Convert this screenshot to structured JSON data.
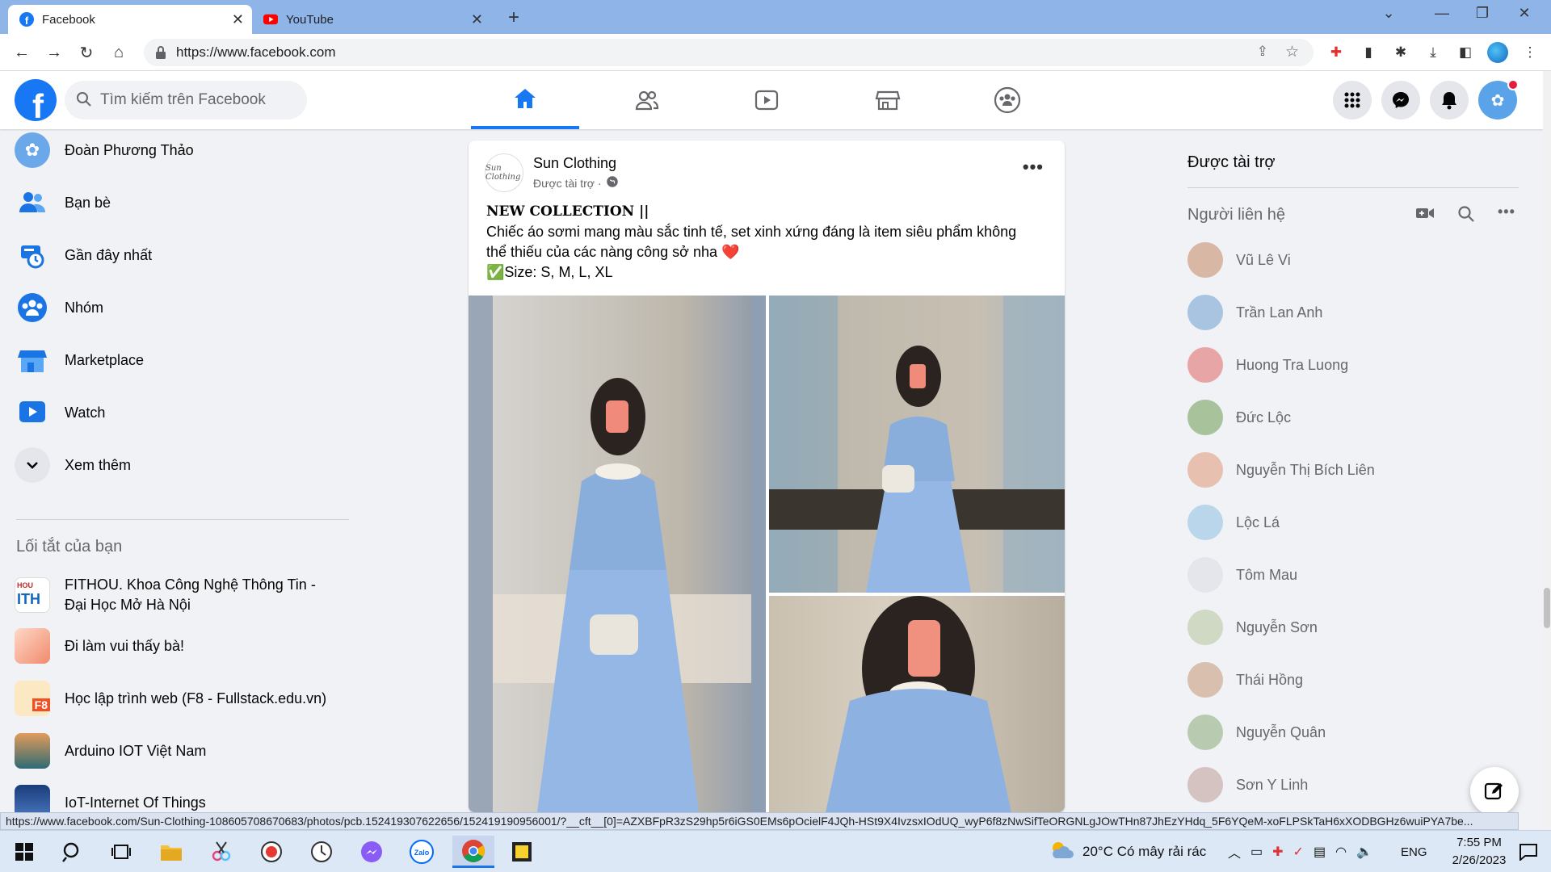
{
  "browser": {
    "tabs": [
      {
        "title": "Facebook",
        "active": true
      },
      {
        "title": "YouTube",
        "active": false
      }
    ],
    "url": "https://www.facebook.com",
    "status_url": "https://www.facebook.com/Sun-Clothing-108605708670683/photos/pcb.152419307622656/152419190956001/?__cft__[0]=AZXBFpR3zS29hp5r6iGS0EMs6pOcielF4JQh-HSt9X4IvzsxIOdUQ_wyP6f8zNwSifTeORGNLgJOwTHn87JhEzYHdq_5F6YQeM-xoFLPSkTaH6xXODBGHz6wuiPYA7be..."
  },
  "facebook": {
    "search_placeholder": "Tìm kiếm trên Facebook",
    "nav_tabs": [
      "home",
      "friends",
      "watch",
      "marketplace",
      "groups"
    ]
  },
  "left_nav": {
    "profile": "Đoàn Phương Thảo",
    "items": [
      "Bạn bè",
      "Gần đây nhất",
      "Nhóm",
      "Marketplace",
      "Watch",
      "Xem thêm"
    ],
    "shortcuts_title": "Lối tắt của bạn",
    "shortcuts": [
      {
        "line1": "FITHOU. Khoa Công Nghệ Thông Tin -",
        "line2": "Đại Học Mở Hà Nội"
      },
      {
        "line1": "Đi làm vui thấy bà!",
        "line2": ""
      },
      {
        "line1": "Học lập trình web (F8 - Fullstack.edu.vn)",
        "line2": ""
      },
      {
        "line1": "Arduino IOT Việt Nam",
        "line2": ""
      },
      {
        "line1": "IoT-Internet Of Things",
        "line2": ""
      }
    ]
  },
  "post": {
    "author": "Sun Clothing",
    "sponsored": "Được tài trợ ·",
    "avatar_text": "Sun Clothing",
    "line1": "NEW COLLECTION ||",
    "line2": "Chiếc áo sơmi mang màu sắc tinh tế, set xinh xứng đáng là item siêu phẩm không",
    "line3": "thể thiếu của các nàng công sở nha ❤️",
    "line4": "✅Size: S, M, L, XL"
  },
  "right_col": {
    "sponsored_title": "Được tài trợ",
    "contacts_title": "Người liên hệ",
    "contacts": [
      "Vũ Lê Vi",
      "Trần Lan Anh",
      "Huong Tra Luong",
      "Đức Lộc",
      "Nguyễn Thị Bích Liên",
      "Lộc Lá",
      "Tôm Mau",
      "Nguyễn Sơn",
      "Thái Hồng",
      "Nguyễn Quân",
      "Sơn Y Linh"
    ]
  },
  "taskbar": {
    "weather": "20°C  Có mây rải rác",
    "lang": "ENG",
    "time": "7:55 PM",
    "date": "2/26/2023"
  },
  "colors": {
    "brand": "#1877f2",
    "notification": "#e41e3f"
  }
}
